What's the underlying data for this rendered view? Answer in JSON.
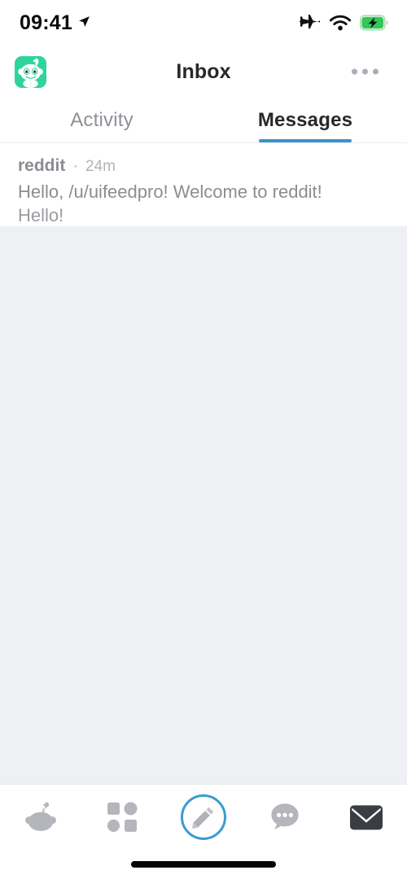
{
  "status_bar": {
    "time": "09:41",
    "location_icon": "location-arrow-icon",
    "airplane_icon": "airplane-mode-icon",
    "wifi_icon": "wifi-icon",
    "battery_icon": "battery-charging-icon",
    "battery_color": "#34c759"
  },
  "header": {
    "title": "Inbox",
    "avatar_icon": "snoo-avatar-icon",
    "avatar_color": "#2fd49c",
    "overflow_icon": "more-horizontal-icon"
  },
  "tabs": [
    {
      "label": "Activity",
      "active": false
    },
    {
      "label": "Messages",
      "active": true
    }
  ],
  "accent_color": "#3a93cc",
  "messages": [
    {
      "author": "reddit",
      "separator": "·",
      "time": "24m",
      "subject": "Hello, /u/uifeedpro! Welcome to reddit!",
      "preview": "Hello!"
    }
  ],
  "bottom_nav": [
    {
      "name": "home",
      "icon": "snoo-home-icon",
      "active": false
    },
    {
      "name": "discover",
      "icon": "grid-squares-icon",
      "active": false
    },
    {
      "name": "create",
      "icon": "pencil-icon",
      "active": false
    },
    {
      "name": "chat",
      "icon": "chat-bubble-dots-icon",
      "active": false
    },
    {
      "name": "inbox",
      "icon": "envelope-icon",
      "active": true
    }
  ],
  "home_indicator": "home-indicator-bar"
}
